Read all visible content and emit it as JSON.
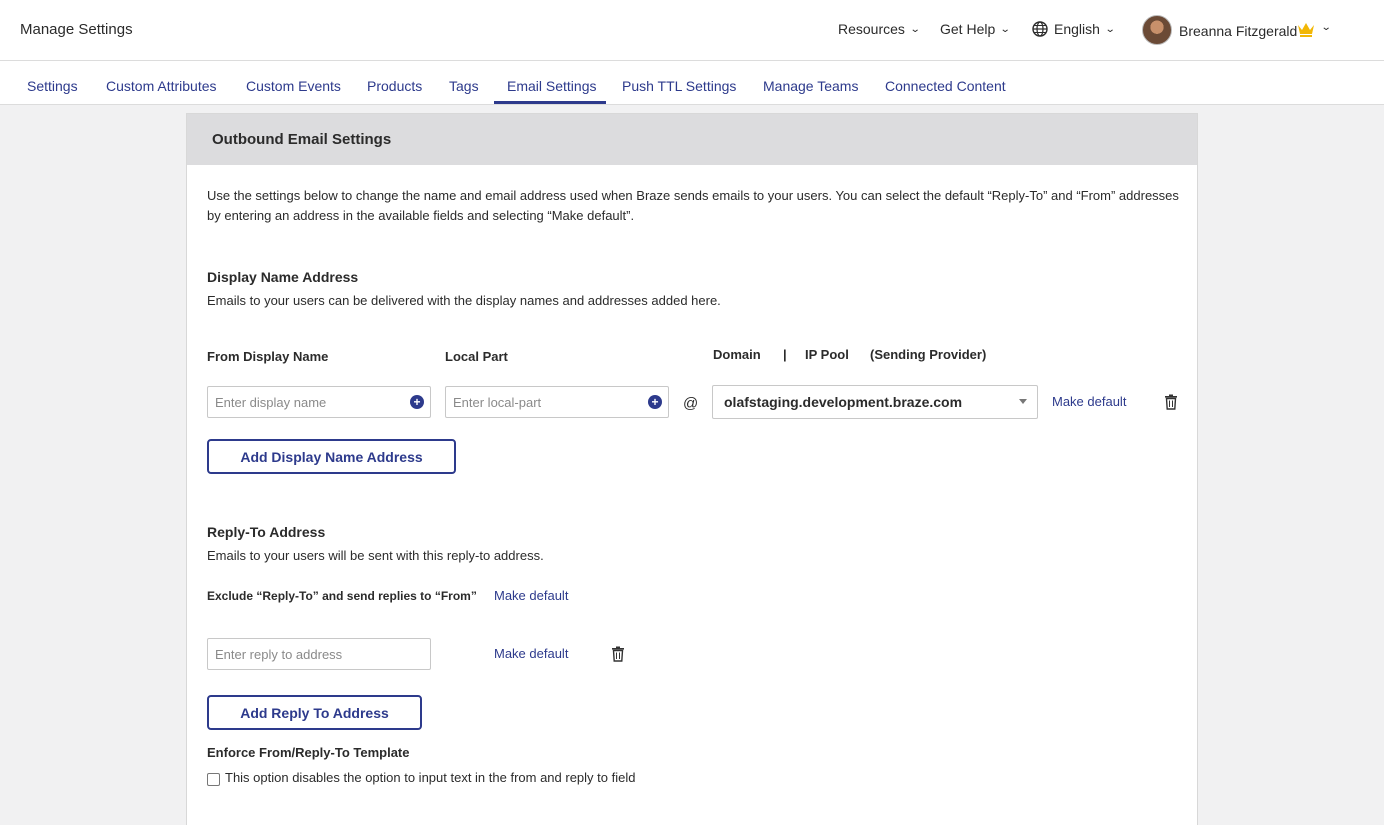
{
  "header": {
    "title": "Manage Settings",
    "resources": "Resources",
    "get_help": "Get Help",
    "language": "English",
    "user_name": "Breanna Fitzgerald"
  },
  "tabs": [
    {
      "label": "Settings"
    },
    {
      "label": "Custom Attributes"
    },
    {
      "label": "Custom Events"
    },
    {
      "label": "Products"
    },
    {
      "label": "Tags"
    },
    {
      "label": "Email Settings",
      "active": true
    },
    {
      "label": "Push TTL Settings"
    },
    {
      "label": "Manage Teams"
    },
    {
      "label": "Connected Content"
    }
  ],
  "card": {
    "title": "Outbound Email Settings",
    "intro": "Use the settings below to change the name and email address used when Braze sends emails to your users. You can select the default “Reply-To” and “From” addresses by entering an address in the available fields and selecting “Make default”."
  },
  "display_name": {
    "heading": "Display Name Address",
    "description": "Emails to your users can be delivered with the display names and addresses added here.",
    "from_label": "From Display Name",
    "local_label": "Local Part",
    "domain_label": "Domain",
    "separator": "|",
    "ip_pool_label": "IP Pool",
    "provider_label": "(Sending Provider)",
    "from_placeholder": "Enter display name",
    "local_placeholder": "Enter local-part",
    "at": "@",
    "domain_value": "olafstaging.development.braze.com",
    "make_default": "Make default",
    "add_button": "Add Display Name Address"
  },
  "reply_to": {
    "heading": "Reply-To Address",
    "description": "Emails to your users will be sent with this reply-to address.",
    "exclude_label": "Exclude “Reply-To” and send replies to “From”",
    "exclude_make_default": "Make default",
    "placeholder": "Enter reply to address",
    "make_default": "Make default",
    "add_button": "Add Reply To Address"
  },
  "enforce": {
    "heading": "Enforce From/Reply-To Template",
    "checkbox_label": "This option disables the option to input text in the from and reply to field",
    "checked": false
  },
  "colors": {
    "accent": "#2d3a8c",
    "crown": "#f2b705"
  }
}
